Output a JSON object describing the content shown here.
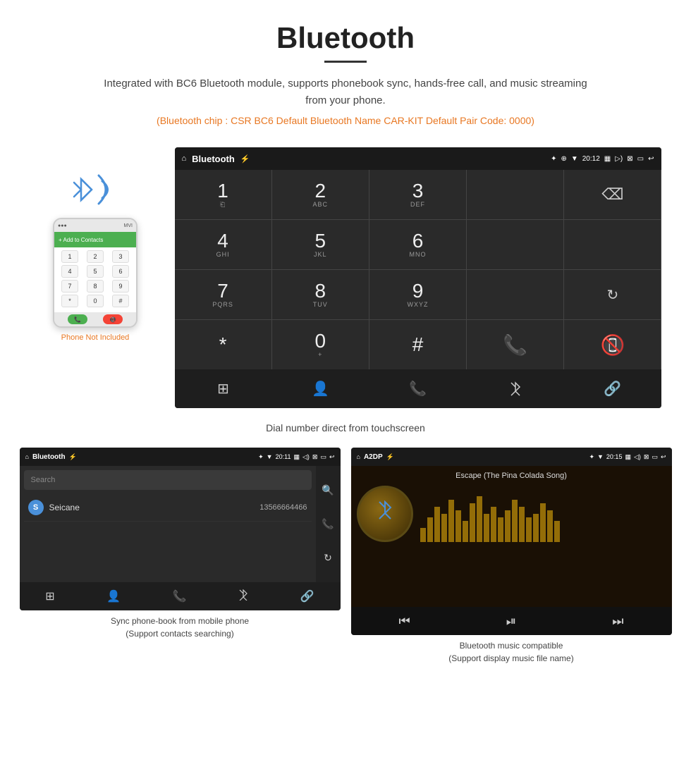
{
  "header": {
    "title": "Bluetooth",
    "description": "Integrated with BC6 Bluetooth module, supports phonebook sync, hands-free call, and music streaming from your phone.",
    "specs": "(Bluetooth chip : CSR BC6    Default Bluetooth Name CAR-KIT    Default Pair Code: 0000)"
  },
  "main_screen": {
    "status_bar": {
      "title": "Bluetooth",
      "time": "20:12"
    },
    "dialpad": {
      "keys": [
        {
          "num": "1",
          "sub": ""
        },
        {
          "num": "2",
          "sub": "ABC"
        },
        {
          "num": "3",
          "sub": "DEF"
        },
        {
          "num": "",
          "sub": ""
        },
        {
          "num": "",
          "sub": "backspace"
        },
        {
          "num": "4",
          "sub": "GHI"
        },
        {
          "num": "5",
          "sub": "JKL"
        },
        {
          "num": "6",
          "sub": "MNO"
        },
        {
          "num": "",
          "sub": ""
        },
        {
          "num": "",
          "sub": ""
        },
        {
          "num": "7",
          "sub": "PQRS"
        },
        {
          "num": "8",
          "sub": "TUV"
        },
        {
          "num": "9",
          "sub": "WXYZ"
        },
        {
          "num": "",
          "sub": ""
        },
        {
          "num": "",
          "sub": "refresh"
        },
        {
          "num": "*",
          "sub": ""
        },
        {
          "num": "0",
          "sub": "+"
        },
        {
          "num": "#",
          "sub": ""
        },
        {
          "num": "",
          "sub": "call-green"
        },
        {
          "num": "",
          "sub": "call-red"
        }
      ],
      "nav": [
        "grid",
        "person",
        "phone",
        "bluetooth",
        "link"
      ]
    }
  },
  "caption_main": "Dial number direct from touchscreen",
  "phonebook_screen": {
    "status_bar": {
      "title": "Bluetooth",
      "time": "20:11"
    },
    "search_placeholder": "Search",
    "contacts": [
      {
        "letter": "S",
        "name": "Seicane",
        "number": "13566664466"
      }
    ],
    "nav": [
      "grid",
      "person",
      "phone",
      "bluetooth",
      "link"
    ]
  },
  "phonebook_caption": {
    "line1": "Sync phone-book from mobile phone",
    "line2": "(Support contacts searching)"
  },
  "music_screen": {
    "status_bar": {
      "title": "A2DP",
      "time": "20:15"
    },
    "song_title": "Escape (The Pina Colada Song)",
    "viz_bars": [
      20,
      35,
      50,
      40,
      60,
      45,
      30,
      55,
      65,
      40,
      50,
      35,
      45,
      60,
      50,
      35,
      40,
      55,
      45,
      30
    ],
    "controls": [
      "prev",
      "play-pause",
      "next"
    ]
  },
  "music_caption": {
    "line1": "Bluetooth music compatible",
    "line2": "(Support display music file name)"
  },
  "phone_mockup": {
    "not_included": "Phone Not Included",
    "add_contacts": "+ Add to Contacts"
  }
}
